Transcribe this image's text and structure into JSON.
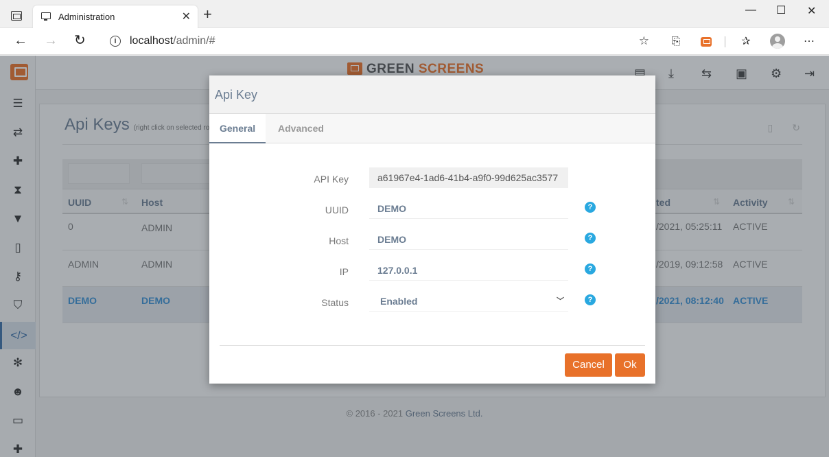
{
  "browser": {
    "tab_title": "Administration",
    "tab_close": "✕",
    "new_tab": "+",
    "url_host": "localhost",
    "url_path": "/admin/#",
    "minimize": "—",
    "maximize": "☐",
    "close": "✕"
  },
  "app": {
    "brand_first": "GREEN",
    "brand_second": "SCREENS",
    "brand_color": "#e8712a",
    "page_title": "Api Keys",
    "page_hint": "(right click on selected ro",
    "columns": {
      "uuid": "UUID",
      "host": "Host",
      "created": "ted",
      "activity": "Activity"
    },
    "rows": [
      {
        "uuid": "0",
        "host": "ADMIN",
        "created": "/2021, 05:25:11",
        "activity": "ACTIVE"
      },
      {
        "uuid": "ADMIN",
        "host": "ADMIN",
        "created": "/2019, 09:12:58",
        "activity": "ACTIVE"
      },
      {
        "uuid": "DEMO",
        "host": "DEMO",
        "created": "/2021, 08:12:40",
        "activity": "ACTIVE"
      }
    ],
    "footer_copy": "© 2016 - 2021",
    "footer_company": "Green Screens Ltd."
  },
  "modal": {
    "title": "Api Key",
    "tabs": [
      "General",
      "Advanced"
    ],
    "fields": {
      "api_key_label": "API Key",
      "api_key_value": "a61967e4-1ad6-41b4-a9f0-99d625ac3577",
      "uuid_label": "UUID",
      "uuid_value": "DEMO",
      "host_label": "Host",
      "host_value": "DEMO",
      "ip_label": "IP",
      "ip_value": "127.0.0.1",
      "status_label": "Status",
      "status_value": "Enabled"
    },
    "cancel_label": "Cancel",
    "ok_label": "Ok"
  }
}
